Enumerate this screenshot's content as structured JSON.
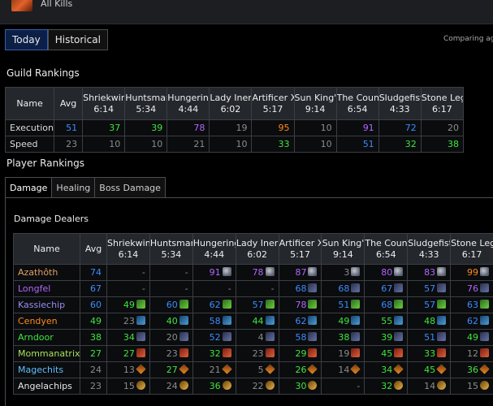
{
  "header": {
    "title": "All Kills"
  },
  "view_tabs": [
    {
      "label": "Today",
      "active": true
    },
    {
      "label": "Historical",
      "active": false
    }
  ],
  "comparing_text": "Comparing aga",
  "colors": {
    "blue": "#3d8bff",
    "green": "#3ee63e",
    "purple": "#b265ff",
    "orange": "#ff8a1a",
    "gray": "#8c8c8c",
    "tab_active": "#0c1f47"
  },
  "guild_rankings": {
    "title": "Guild Rankings",
    "columns": [
      {
        "boss": "Shriekwin",
        "time": "6:14"
      },
      {
        "boss": "Huntsmar",
        "time": "5:34"
      },
      {
        "boss": "Hungering",
        "time": "4:44"
      },
      {
        "boss": "Lady Iner",
        "time": "6:02"
      },
      {
        "boss": "Artificer X",
        "time": "5:17"
      },
      {
        "boss": "Sun King'",
        "time": "9:14"
      },
      {
        "boss": "The Coun",
        "time": "6:54"
      },
      {
        "boss": "Sludgefist",
        "time": "4:33"
      },
      {
        "boss": "Stone Leg",
        "time": "6:17"
      }
    ],
    "head_name": "Name",
    "head_avg": "Avg",
    "rows": [
      {
        "name": "Execution",
        "avg": {
          "v": "51",
          "c": "blue"
        },
        "cells": [
          {
            "v": "37",
            "c": "green"
          },
          {
            "v": "39",
            "c": "green"
          },
          {
            "v": "78",
            "c": "purple"
          },
          {
            "v": "19",
            "c": "gray"
          },
          {
            "v": "95",
            "c": "orange"
          },
          {
            "v": "10",
            "c": "gray"
          },
          {
            "v": "91",
            "c": "purple"
          },
          {
            "v": "72",
            "c": "blue"
          },
          {
            "v": "20",
            "c": "gray"
          }
        ]
      },
      {
        "name": "Speed",
        "avg": {
          "v": "23",
          "c": "gray"
        },
        "cells": [
          {
            "v": "10",
            "c": "gray"
          },
          {
            "v": "10",
            "c": "gray"
          },
          {
            "v": "21",
            "c": "gray"
          },
          {
            "v": "10",
            "c": "gray"
          },
          {
            "v": "33",
            "c": "green"
          },
          {
            "v": "10",
            "c": "gray"
          },
          {
            "v": "51",
            "c": "blue"
          },
          {
            "v": "32",
            "c": "green"
          },
          {
            "v": "38",
            "c": "green"
          }
        ]
      }
    ]
  },
  "player_rankings": {
    "title": "Player Rankings",
    "tabs": [
      {
        "label": "Damage",
        "active": true
      },
      {
        "label": "Healing",
        "active": false
      },
      {
        "label": "Boss Damage",
        "active": false
      }
    ],
    "subtitle": "Damage Dealers",
    "head_name": "Name",
    "head_avg": "Avg",
    "columns": [
      {
        "boss": "Shriekwin",
        "time": "6:14"
      },
      {
        "boss": "Huntsmar",
        "time": "5:34"
      },
      {
        "boss": "Hungering",
        "time": "4:44"
      },
      {
        "boss": "Lady Iner",
        "time": "6:02"
      },
      {
        "boss": "Artificer X",
        "time": "5:17"
      },
      {
        "boss": "Sun King'",
        "time": "9:14"
      },
      {
        "boss": "The Coun",
        "time": "6:54"
      },
      {
        "boss": "Sludgefist",
        "time": "4:33"
      },
      {
        "boss": "Stone Leg",
        "time": "6:17"
      }
    ],
    "rows": [
      {
        "name": "Azathôth",
        "nc": "#e0a060",
        "avg": {
          "v": "74",
          "c": "blue"
        },
        "icon": "boss",
        "cells": [
          {
            "v": "-",
            "c": "gray",
            "i": false
          },
          {
            "v": "-",
            "c": "gray",
            "i": false
          },
          {
            "v": "91",
            "c": "purple"
          },
          {
            "v": "78",
            "c": "purple"
          },
          {
            "v": "87",
            "c": "purple"
          },
          {
            "v": "3",
            "c": "gray"
          },
          {
            "v": "80",
            "c": "purple"
          },
          {
            "v": "83",
            "c": "purple"
          },
          {
            "v": "99",
            "c": "orange"
          }
        ]
      },
      {
        "name": "Longfel",
        "nc": "#b265ff",
        "avg": {
          "v": "67",
          "c": "blue"
        },
        "icon": "spec-d",
        "cells": [
          {
            "v": "-",
            "c": "gray",
            "i": false
          },
          {
            "v": "-",
            "c": "gray",
            "i": false
          },
          {
            "v": "-",
            "c": "gray",
            "i": false
          },
          {
            "v": "-",
            "c": "gray",
            "i": false
          },
          {
            "v": "68",
            "c": "blue"
          },
          {
            "v": "68",
            "c": "blue"
          },
          {
            "v": "67",
            "c": "blue"
          },
          {
            "v": "57",
            "c": "blue"
          },
          {
            "v": "76",
            "c": "purple"
          }
        ]
      },
      {
        "name": "Kassiechip",
        "nc": "#9a8cf2",
        "avg": {
          "v": "60",
          "c": "blue"
        },
        "icon": "spec-g",
        "cells": [
          {
            "v": "49",
            "c": "green"
          },
          {
            "v": "60",
            "c": "blue"
          },
          {
            "v": "62",
            "c": "blue"
          },
          {
            "v": "57",
            "c": "blue"
          },
          {
            "v": "78",
            "c": "purple"
          },
          {
            "v": "51",
            "c": "blue"
          },
          {
            "v": "68",
            "c": "blue"
          },
          {
            "v": "57",
            "c": "blue"
          },
          {
            "v": "63",
            "c": "blue"
          }
        ]
      },
      {
        "name": "Cendyen",
        "nc": "#ff8a1a",
        "avg": {
          "v": "49",
          "c": "green"
        },
        "icon": "spec-b",
        "cells": [
          {
            "v": "23",
            "c": "gray"
          },
          {
            "v": "40",
            "c": "green"
          },
          {
            "v": "58",
            "c": "blue"
          },
          {
            "v": "44",
            "c": "green"
          },
          {
            "v": "62",
            "c": "blue"
          },
          {
            "v": "49",
            "c": "green"
          },
          {
            "v": "55",
            "c": "green"
          },
          {
            "v": "48",
            "c": "green"
          },
          {
            "v": "62",
            "c": "blue"
          }
        ]
      },
      {
        "name": "Arndoor",
        "nc": "#3ee63e",
        "avg": {
          "v": "38",
          "c": "green"
        },
        "icon": "spec-d",
        "cells": [
          {
            "v": "34",
            "c": "green"
          },
          {
            "v": "20",
            "c": "gray"
          },
          {
            "v": "52",
            "c": "blue"
          },
          {
            "v": "4",
            "c": "gray"
          },
          {
            "v": "58",
            "c": "blue"
          },
          {
            "v": "38",
            "c": "green"
          },
          {
            "v": "39",
            "c": "green"
          },
          {
            "v": "51",
            "c": "blue"
          },
          {
            "v": "49",
            "c": "green"
          }
        ]
      },
      {
        "name": "Mommanatrixx",
        "nc": "#a6e05a",
        "avg": {
          "v": "27",
          "c": "green"
        },
        "icon": "spec-r",
        "cells": [
          {
            "v": "27",
            "c": "green"
          },
          {
            "v": "23",
            "c": "gray"
          },
          {
            "v": "32",
            "c": "green"
          },
          {
            "v": "23",
            "c": "gray"
          },
          {
            "v": "29",
            "c": "green"
          },
          {
            "v": "19",
            "c": "gray"
          },
          {
            "v": "45",
            "c": "green"
          },
          {
            "v": "33",
            "c": "green"
          },
          {
            "v": "12",
            "c": "gray"
          }
        ]
      },
      {
        "name": "Magechits",
        "nc": "#5fbfff",
        "avg": {
          "v": "24",
          "c": "gray"
        },
        "icon": "spec-w",
        "cells": [
          {
            "v": "13",
            "c": "gray"
          },
          {
            "v": "27",
            "c": "green"
          },
          {
            "v": "21",
            "c": "gray"
          },
          {
            "v": "5",
            "c": "gray"
          },
          {
            "v": "26",
            "c": "green"
          },
          {
            "v": "14",
            "c": "gray"
          },
          {
            "v": "34",
            "c": "green"
          },
          {
            "v": "45",
            "c": "green"
          },
          {
            "v": "36",
            "c": "green"
          }
        ]
      },
      {
        "name": "Angelachips",
        "nc": "#e8e8e8",
        "avg": {
          "v": "23",
          "c": "gray"
        },
        "icon": "spec-o",
        "cells": [
          {
            "v": "15",
            "c": "gray"
          },
          {
            "v": "24",
            "c": "gray"
          },
          {
            "v": "36",
            "c": "green"
          },
          {
            "v": "22",
            "c": "gray"
          },
          {
            "v": "30",
            "c": "green"
          },
          {
            "v": "-",
            "c": "gray",
            "i": false
          },
          {
            "v": "32",
            "c": "green"
          },
          {
            "v": "14",
            "c": "gray"
          },
          {
            "v": "15",
            "c": "gray"
          }
        ]
      }
    ]
  }
}
